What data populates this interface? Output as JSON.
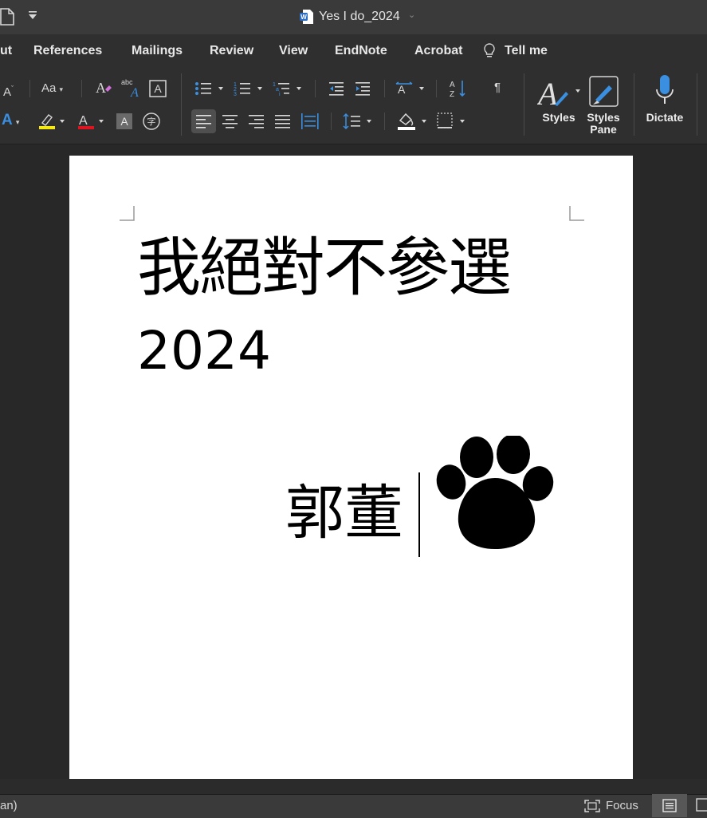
{
  "window": {
    "title": "Yes I do_2024"
  },
  "tabs": [
    {
      "label": "ut"
    },
    {
      "label": "References"
    },
    {
      "label": "Mailings"
    },
    {
      "label": "Review"
    },
    {
      "label": "View"
    },
    {
      "label": "EndNote"
    },
    {
      "label": "Acrobat"
    },
    {
      "label": "Tell me"
    }
  ],
  "ribbon": {
    "font_size_label": "Aa",
    "font_a_label": "A",
    "abc_label": "abc",
    "styles_label": "Styles",
    "styles_pane_label_1": "Styles",
    "styles_pane_label_2": "Pane",
    "dictate_label": "Dictate",
    "pilcrow": "¶",
    "highlight_color": "#f5e90f",
    "font_color": "#e0141e",
    "accent": "#3a8fe0"
  },
  "document": {
    "heading": "我絕對不參選",
    "year": "2024",
    "signature": "郭董"
  },
  "status": {
    "left_text": "an)",
    "focus_label": "Focus"
  }
}
